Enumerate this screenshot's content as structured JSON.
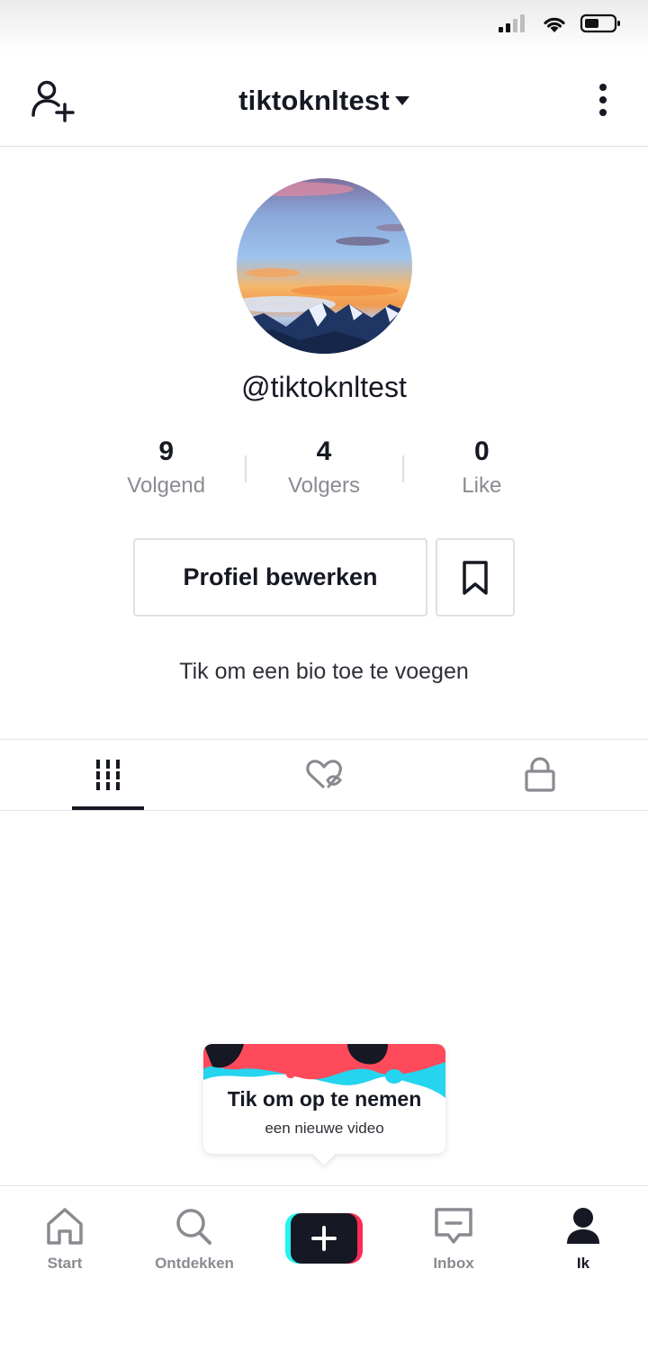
{
  "status_bar": {
    "signal_icon": "signal-icon",
    "wifi_icon": "wifi-icon",
    "battery_icon": "battery-icon"
  },
  "header": {
    "username": "tiktoknltest",
    "add_user_icon": "add-user-icon",
    "dropdown_icon": "caret-down-icon",
    "more_icon": "more-vertical-icon"
  },
  "profile": {
    "handle": "@tiktoknltest",
    "stats": [
      {
        "value": "9",
        "label": "Volgend"
      },
      {
        "value": "4",
        "label": "Volgers"
      },
      {
        "value": "0",
        "label": "Like"
      }
    ],
    "edit_label": "Profiel bewerken",
    "bio_prompt": "Tik om een bio toe te voegen"
  },
  "tabs": [
    {
      "icon": "grid-icon",
      "active": true
    },
    {
      "icon": "hidden-likes-icon",
      "active": false
    },
    {
      "icon": "lock-icon",
      "active": false
    }
  ],
  "tooltip": {
    "title": "Tik om op te nemen",
    "subtitle": "een nieuwe video"
  },
  "bottom_nav": [
    {
      "label": "Start",
      "icon": "home-icon"
    },
    {
      "label": "Ontdekken",
      "icon": "search-icon"
    },
    {
      "label": "",
      "icon": "plus-icon"
    },
    {
      "label": "Inbox",
      "icon": "inbox-icon"
    },
    {
      "label": "Ik",
      "icon": "profile-icon",
      "active": true
    }
  ],
  "colors": {
    "accent_cyan": "#25f4ee",
    "accent_red": "#fe2c55",
    "text": "#161823",
    "muted": "#8a8b91"
  }
}
